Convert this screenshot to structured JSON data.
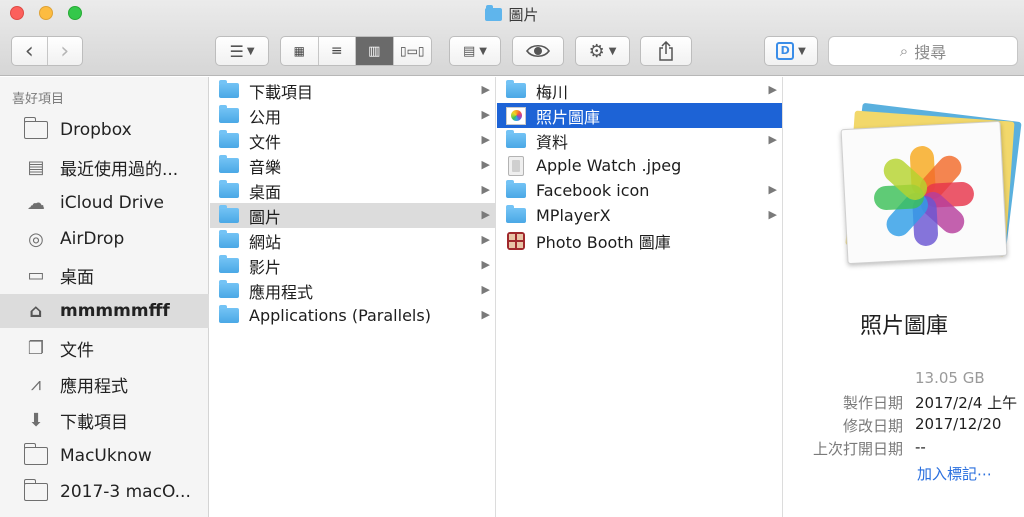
{
  "window": {
    "title": "圖片"
  },
  "toolbar": {
    "back_label": "‹",
    "forward_label": "›",
    "search_placeholder": "搜尋"
  },
  "sidebar": {
    "header": "喜好項目",
    "items": [
      {
        "label": "Dropbox",
        "icon": "folder-icon"
      },
      {
        "label": "最近使用過的...",
        "icon": "recents-icon"
      },
      {
        "label": "iCloud Drive",
        "icon": "cloud-icon"
      },
      {
        "label": "AirDrop",
        "icon": "airdrop-icon"
      },
      {
        "label": "桌面",
        "icon": "desktop-icon"
      },
      {
        "label": "mmmmmfff",
        "icon": "home-icon",
        "selected": true
      },
      {
        "label": "文件",
        "icon": "document-icon"
      },
      {
        "label": "應用程式",
        "icon": "applications-icon"
      },
      {
        "label": "下載項目",
        "icon": "download-icon"
      },
      {
        "label": "MacUknow",
        "icon": "folder-icon"
      },
      {
        "label": "2017-3 macO...",
        "icon": "folder-icon"
      }
    ]
  },
  "column1": {
    "items": [
      {
        "label": "下載項目",
        "has_children": true
      },
      {
        "label": "公用",
        "has_children": true
      },
      {
        "label": "文件",
        "has_children": true
      },
      {
        "label": "音樂",
        "has_children": true
      },
      {
        "label": "桌面",
        "has_children": true
      },
      {
        "label": "圖片",
        "has_children": true,
        "selected": true
      },
      {
        "label": "網站",
        "has_children": true
      },
      {
        "label": "影片",
        "has_children": true
      },
      {
        "label": "應用程式",
        "has_children": true
      },
      {
        "label": "Applications (Parallels)",
        "has_children": true
      }
    ]
  },
  "column2": {
    "items": [
      {
        "label": "梅川",
        "kind": "folder",
        "has_children": true
      },
      {
        "label": "照片圖庫",
        "kind": "photos-library",
        "has_children": false,
        "selected": true
      },
      {
        "label": "資料",
        "kind": "folder",
        "has_children": true
      },
      {
        "label": "Apple Watch .jpeg",
        "kind": "image",
        "has_children": false
      },
      {
        "label": "Facebook icon",
        "kind": "folder",
        "has_children": true
      },
      {
        "label": "MPlayerX",
        "kind": "folder",
        "has_children": true
      },
      {
        "label": "Photo Booth 圖庫",
        "kind": "photo-booth",
        "has_children": false
      }
    ]
  },
  "preview": {
    "title": "照片圖庫",
    "size": "13.05 GB",
    "meta": [
      {
        "label": "製作日期",
        "value": "2017/2/4 上午"
      },
      {
        "label": "修改日期",
        "value": "2017/12/20"
      },
      {
        "label": "上次打開日期",
        "value": "--"
      }
    ],
    "add_tags": "加入標記⋯"
  },
  "colors": {
    "selection_blue": "#1d63d6",
    "selection_gray": "#dcdcdc",
    "folder_blue": "#5fb5ec",
    "link_blue": "#2a6fde"
  }
}
